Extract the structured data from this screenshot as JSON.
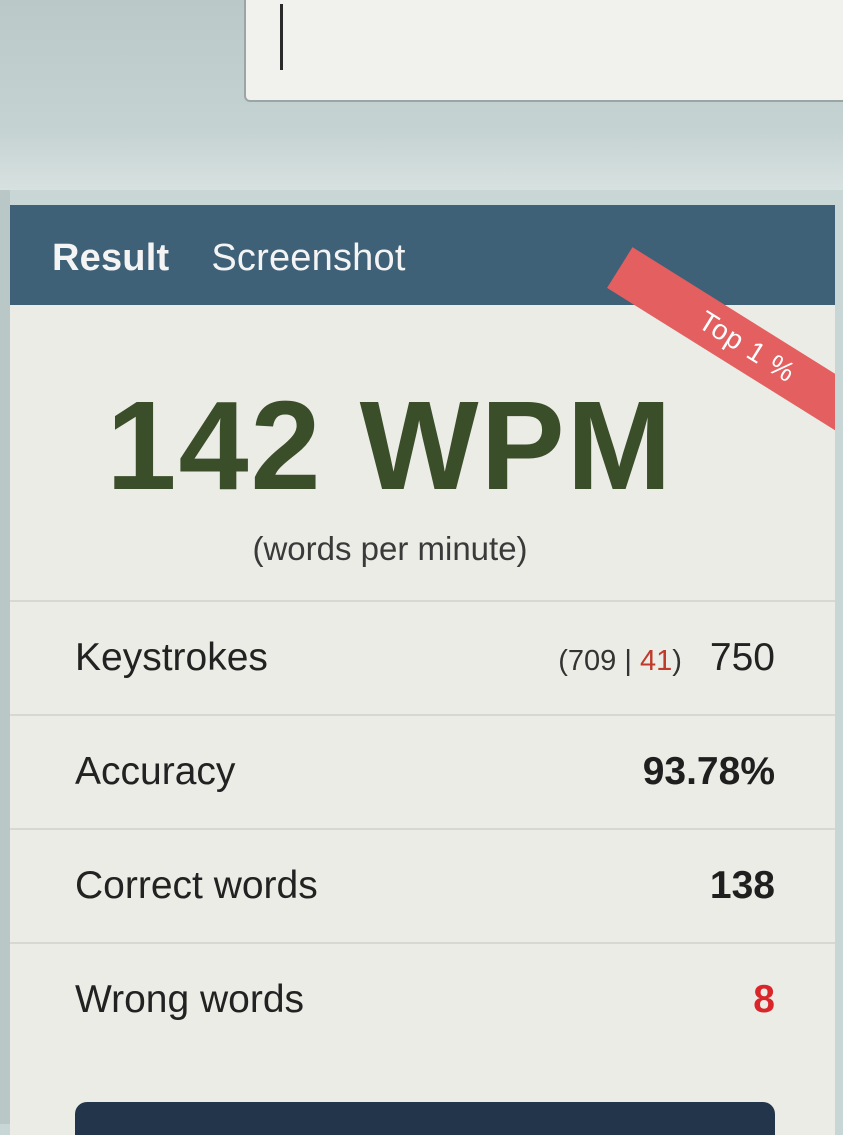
{
  "tabs": {
    "result": "Result",
    "screenshot": "Screenshot"
  },
  "badge": "Top 1 %",
  "speed": {
    "value": "142 WPM",
    "unit_label": "(words per minute)"
  },
  "stats": {
    "keystrokes": {
      "label": "Keystrokes",
      "correct": "709",
      "separator": "|",
      "wrong": "41",
      "open": "(",
      "close": ")",
      "total": "750"
    },
    "accuracy": {
      "label": "Accuracy",
      "value": "93.78%"
    },
    "correct_words": {
      "label": "Correct words",
      "value": "138"
    },
    "wrong_words": {
      "label": "Wrong words",
      "value": "8"
    }
  },
  "colors": {
    "header": "#3e6178",
    "wpm": "#3b4e2a",
    "badge": "#e45f5f",
    "error": "#d9262b"
  }
}
